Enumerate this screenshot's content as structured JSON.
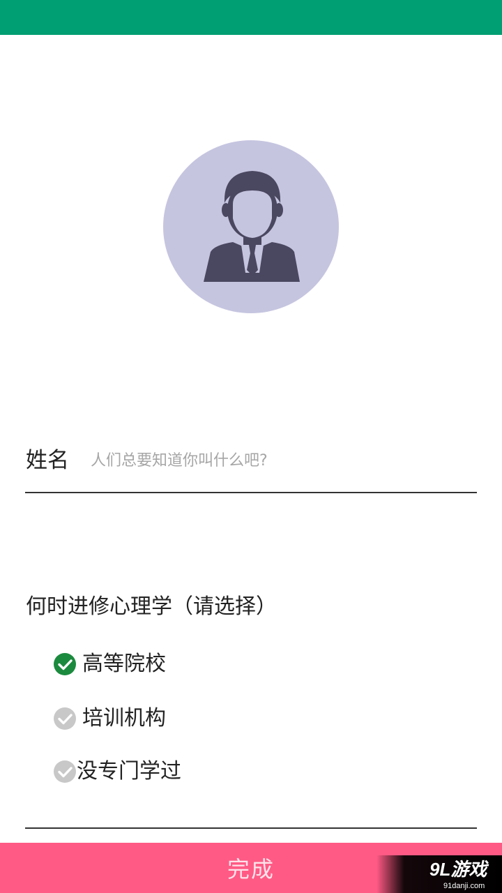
{
  "theme": {
    "status_bar_color": "#009E73",
    "avatar_bg_color": "#C6C5E0",
    "avatar_figure_color": "#4A4760",
    "accent_check_color": "#1B8A3E",
    "inactive_check_color": "#C8C8C8",
    "done_button_color": "#FF5A85"
  },
  "profile": {
    "avatar_icon": "person-in-suit-icon"
  },
  "form": {
    "name_label": "姓名",
    "name_placeholder": "人们总要知道你叫什么吧?",
    "name_value": "",
    "question": "何时进修心理学（请选择）",
    "options": [
      {
        "label": "高等院校",
        "selected": true
      },
      {
        "label": "培训机构",
        "selected": false
      },
      {
        "label": "没专门学过",
        "selected": false
      }
    ]
  },
  "footer": {
    "done_label": "完成"
  },
  "watermark": {
    "brand": "9L游戏",
    "site": "91danji.com"
  }
}
